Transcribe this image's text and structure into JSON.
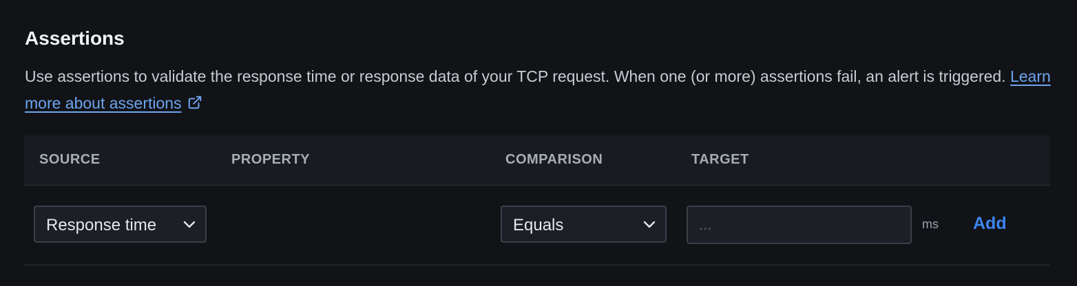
{
  "section": {
    "title": "Assertions",
    "description": "Use assertions to validate the response time or response data of your TCP request. When one (or more) assertions fail, an alert is triggered.",
    "learn_more_label": "Learn more about assertions"
  },
  "table": {
    "columns": {
      "source": "SOURCE",
      "property": "PROPERTY",
      "comparison": "COMPARISON",
      "target": "TARGET"
    },
    "row": {
      "source_value": "Response time",
      "comparison_value": "Equals",
      "target_placeholder": "...",
      "target_unit": "ms",
      "add_label": "Add"
    }
  },
  "icons": {
    "link": "external-link-icon",
    "dropdown": "chevron-down-icon"
  },
  "colors": {
    "background": "#111317",
    "link": "#6ea4ee",
    "accent": "#3d86f0"
  }
}
